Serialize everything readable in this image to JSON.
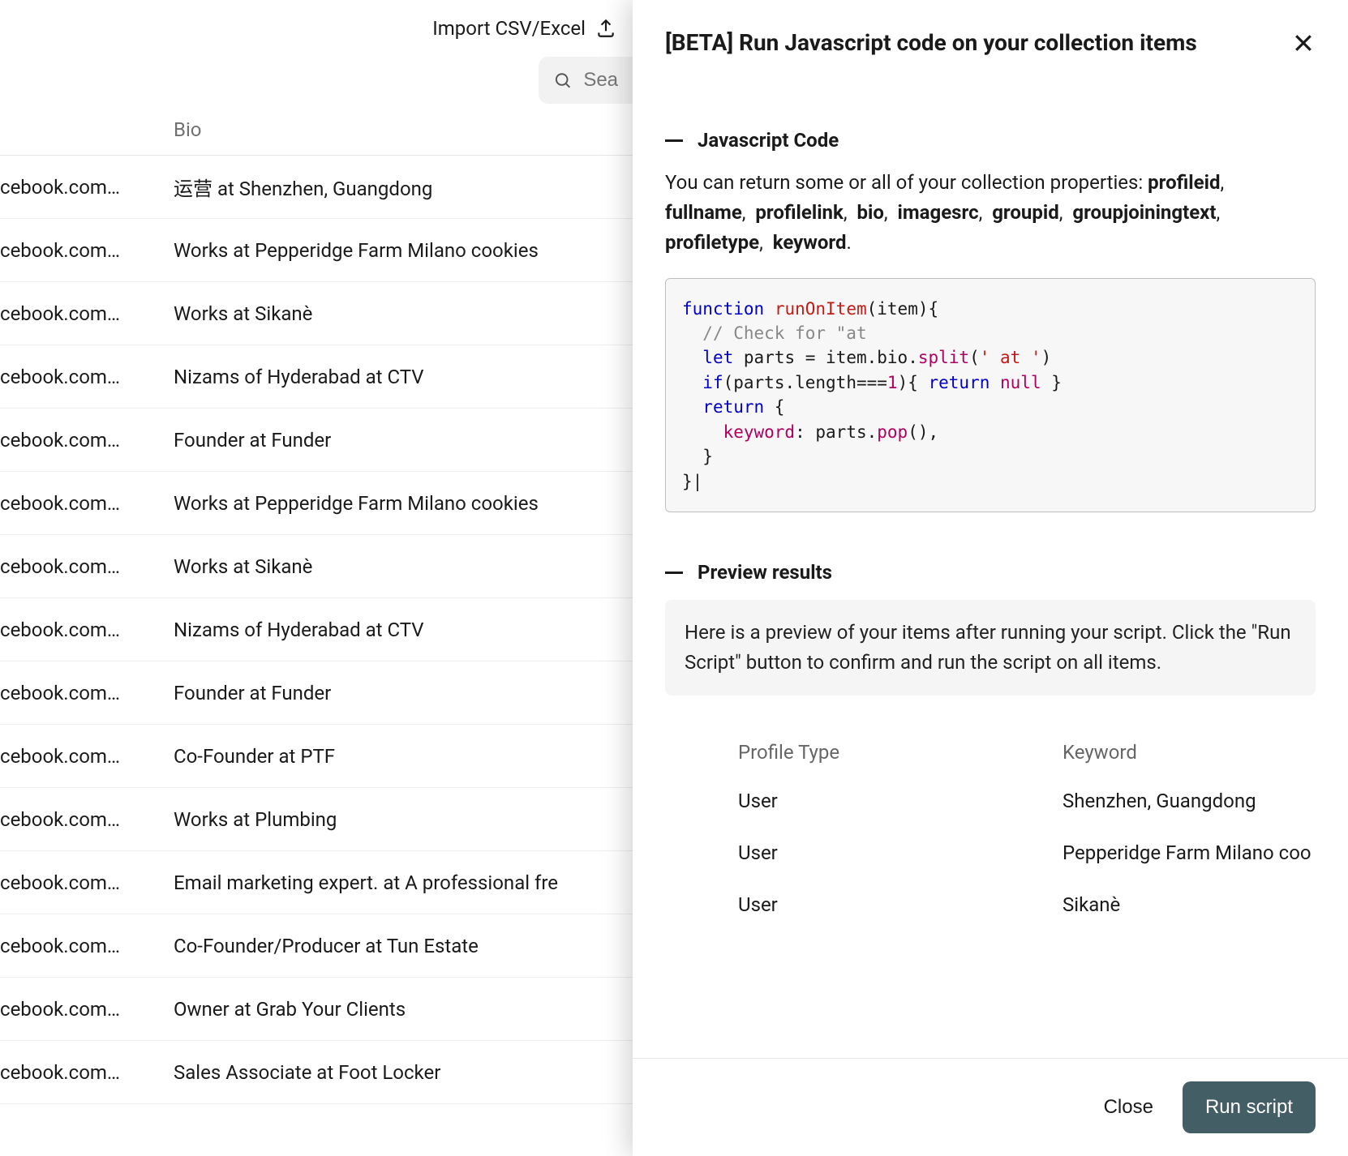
{
  "topbar": {
    "import_label": "Import CSV/Excel",
    "search_placeholder": "Sea"
  },
  "table": {
    "headers": {
      "bio": "Bio"
    },
    "link_fragment": "cebook.com…",
    "rows": [
      {
        "bio": "运营 at Shenzhen, Guangdong"
      },
      {
        "bio": "Works at Pepperidge Farm Milano cookies"
      },
      {
        "bio": "Works at Sikanè"
      },
      {
        "bio": "Nizams of Hyderabad at CTV"
      },
      {
        "bio": "Founder at Funder"
      },
      {
        "bio": "Works at Pepperidge Farm Milano cookies"
      },
      {
        "bio": "Works at Sikanè"
      },
      {
        "bio": "Nizams of Hyderabad at CTV"
      },
      {
        "bio": "Founder at Funder"
      },
      {
        "bio": "Co-Founder at PTF"
      },
      {
        "bio": "Works at Plumbing"
      },
      {
        "bio": "Email marketing expert. at A professional fre"
      },
      {
        "bio": "Co-Founder/Producer at Tun Estate"
      },
      {
        "bio": "Owner at Grab Your Clients"
      },
      {
        "bio": "Sales Associate at Foot Locker"
      }
    ]
  },
  "drawer": {
    "title": "[BETA] Run Javascript code on your collection items",
    "section1": {
      "heading": "Javascript Code",
      "intro_prefix": "You can return some or all of your collection properties: ",
      "props": [
        "profileid",
        "fullname",
        "profilelink",
        "bio",
        "imagesrc",
        "groupid",
        "groupjoiningtext",
        "profiletype",
        "keyword"
      ],
      "code": {
        "kw_function": "function",
        "fn_name": "runOnItem",
        "param": "item",
        "comment": "// Check for \"at",
        "kw_let": "let",
        "var_parts": "parts",
        "item_bio": "item.bio",
        "method_split": "split",
        "split_arg": "' at '",
        "kw_if": "if",
        "cond_lhs": "parts.length",
        "op_eq": "===",
        "cond_rhs": "1",
        "kw_return": "return",
        "kw_null": "null",
        "ret_key": "keyword",
        "ret_val_obj": "parts",
        "method_pop": "pop"
      }
    },
    "section2": {
      "heading": "Preview results",
      "note": "Here is a preview of your items after running your script. Click the \"Run Script\" button to confirm and run the script on all items.",
      "columns": {
        "c1": "Profile Type",
        "c2": "Keyword"
      },
      "rows": [
        {
          "type": "User",
          "keyword": "Shenzhen, Guangdong"
        },
        {
          "type": "User",
          "keyword": "Pepperidge Farm Milano coo"
        },
        {
          "type": "User",
          "keyword": "Sikanè"
        }
      ]
    },
    "footer": {
      "close": "Close",
      "run": "Run script"
    }
  }
}
